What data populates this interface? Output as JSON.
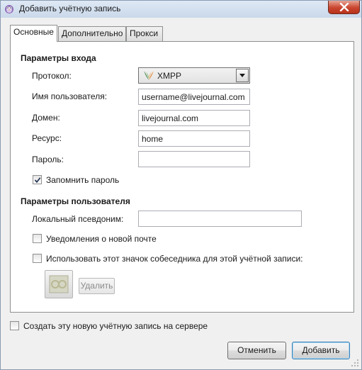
{
  "window": {
    "title": "Добавить учётную запись",
    "accent": "#c9452e"
  },
  "tabs": [
    {
      "label": "Основные",
      "active": true
    },
    {
      "label": "Дополнительно",
      "active": false
    },
    {
      "label": "Прокси",
      "active": false
    }
  ],
  "login": {
    "section_title": "Параметры входа",
    "protocol_label": "Протокол:",
    "protocol_value": "XMPP",
    "protocol_icon": "xmpp-icon",
    "username_label": "Имя пользователя:",
    "username_value": "username@livejournal.com",
    "domain_label": "Домен:",
    "domain_value": "livejournal.com",
    "resource_label": "Ресурс:",
    "resource_value": "home",
    "password_label": "Пароль:",
    "password_value": "",
    "remember_label": "Запомнить пароль",
    "remember_checked": true
  },
  "user": {
    "section_title": "Параметры пользователя",
    "alias_label": "Локальный псевдоним:",
    "alias_value": "",
    "mail_label": "Уведомления о новой почте",
    "mail_checked": false,
    "buddy_icon_label": "Использовать этот значок собеседника для этой учётной записи:",
    "buddy_icon_checked": false,
    "remove_label": "Удалить"
  },
  "footer": {
    "create_label": "Создать эту новую учётную запись на сервере",
    "create_checked": false,
    "cancel_label": "Отменить",
    "add_label": "Добавить"
  }
}
